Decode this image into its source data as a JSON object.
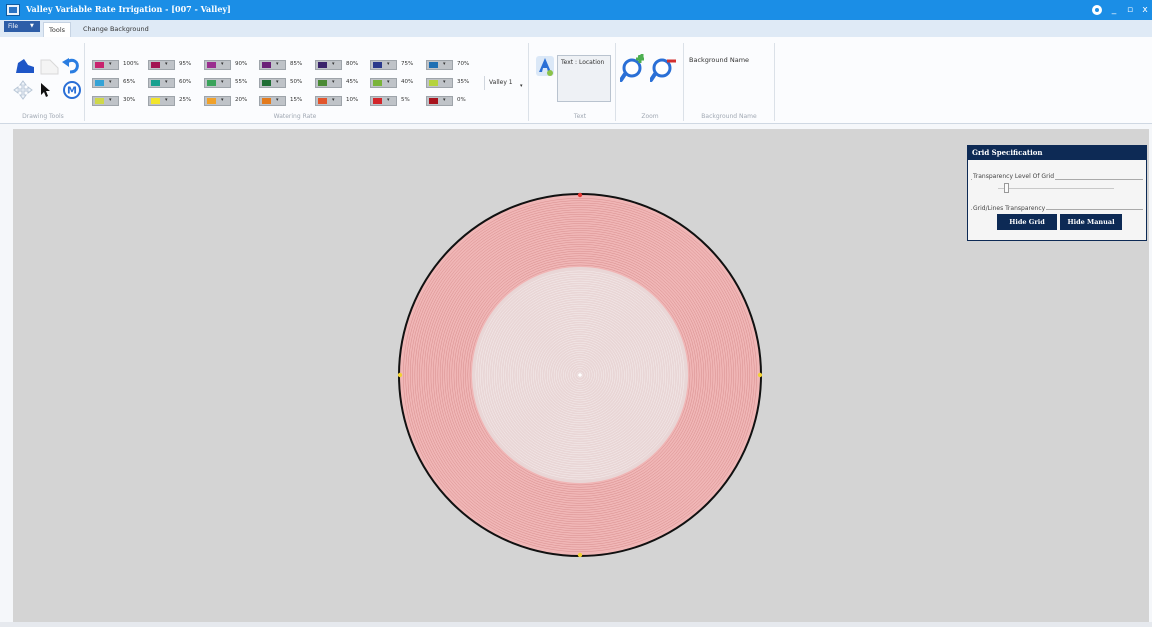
{
  "window": {
    "title": "Valley Variable Rate Irrigation - [007 - Valley]",
    "minimize_glyph": "_",
    "maximize_glyph": "▫",
    "close_glyph": "x"
  },
  "menu": {
    "file_label": "File",
    "tabs": [
      {
        "label": "Tools",
        "active": true
      },
      {
        "label": "Change Background",
        "active": false
      }
    ]
  },
  "ribbon": {
    "groups": {
      "drawing_tools": "Drawing Tools",
      "watering_rate": "Watering Rate",
      "text": "Text",
      "zoom": "Zoom",
      "background_name": "Background Name"
    },
    "watering_rates": [
      {
        "pct": "100%",
        "color": "#c8236e"
      },
      {
        "pct": "95%",
        "color": "#a31553"
      },
      {
        "pct": "90%",
        "color": "#9a2f8f"
      },
      {
        "pct": "85%",
        "color": "#6b2078"
      },
      {
        "pct": "80%",
        "color": "#3a236b"
      },
      {
        "pct": "75%",
        "color": "#2b3a8c"
      },
      {
        "pct": "70%",
        "color": "#1f6fb3"
      },
      {
        "pct": "65%",
        "color": "#35a3d6"
      },
      {
        "pct": "60%",
        "color": "#17a08f"
      },
      {
        "pct": "55%",
        "color": "#3aa35a"
      },
      {
        "pct": "50%",
        "color": "#1f6e35"
      },
      {
        "pct": "45%",
        "color": "#4a8a34"
      },
      {
        "pct": "40%",
        "color": "#7ab43a"
      },
      {
        "pct": "35%",
        "color": "#b5d33d"
      },
      {
        "pct": "30%",
        "color": "#cfd84a"
      },
      {
        "pct": "25%",
        "color": "#f2e52c"
      },
      {
        "pct": "20%",
        "color": "#f0a12a"
      },
      {
        "pct": "15%",
        "color": "#e37b1e"
      },
      {
        "pct": "10%",
        "color": "#e2552c"
      },
      {
        "pct": "5%",
        "color": "#d2262b"
      },
      {
        "pct": "0%",
        "color": "#a8131d"
      }
    ],
    "valley_dropdown": "Valley 1",
    "text_location_label": "Text : Location",
    "background_name_label": "Background Name"
  },
  "grid_panel": {
    "title": "Grid Specification",
    "transparency_label": "Transparency Level Of Grid",
    "lines_label": "Grid/Lines Transparency",
    "slider_value": 0.05,
    "hide_grid": "Hide Grid",
    "hide_manual": "Hide Manual"
  },
  "colors": {
    "titlebar": "#1b8ee6",
    "panel_navy": "#0d2a55",
    "field_outer": "#f2b8b8",
    "field_inner": "#ebd3d3"
  }
}
